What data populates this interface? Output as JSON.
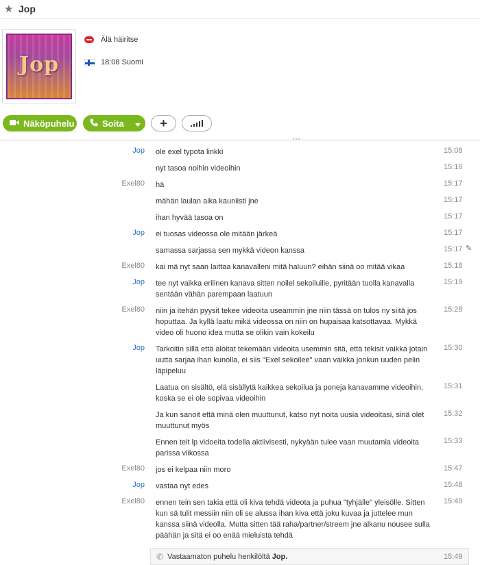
{
  "header": {
    "title": "Jop"
  },
  "profile": {
    "avatar_text": "Jop",
    "status": "Älä häiritse",
    "local_time": "18:08 Suomi"
  },
  "actions": {
    "video_call": "Näköpuhelu",
    "call": "Soita"
  },
  "messages": [
    {
      "sender": "Jop",
      "text": "ole exel typota linkki",
      "time": "15:08"
    },
    {
      "sender": "",
      "text": "nyt tasoa noihin videoihin",
      "time": "15:16"
    },
    {
      "sender": "Exel80",
      "text": "hä",
      "time": "15:17"
    },
    {
      "sender": "",
      "text": "mähän laulan aika kauniisti jne",
      "time": "15:17"
    },
    {
      "sender": "",
      "text": "ihan hyvää tasoa on",
      "time": "15:17"
    },
    {
      "sender": "Jop",
      "text": "ei tuosas videossa ole mitään järkeä",
      "time": "15:17"
    },
    {
      "sender": "",
      "text": "samassa sarjassa sen mykkä videon kanssa",
      "time": "15:17"
    },
    {
      "sender": "Exel80",
      "text": "kai mä nyt saan laittaa kanavalleni mitä haluun? eihän siinä oo mitää vikaa",
      "time": "15:18"
    },
    {
      "sender": "Jop",
      "text": "tee nyt vaikka erilinen kanava sitten noilel sekoiluille, pyritään tuolla kanavalla sentään vähän parempaan laatuun",
      "time": "15:19"
    },
    {
      "sender": "Exel80",
      "text": "niin ja itehän pyysit tekee videoita useammin jne niin tässä on tulos ny siitä jos hoputtaa. Ja kyllä laatu mikä videossa on niin on hupaisaa katsottavaa. Mykkä video oli huono idea mutta se olikin vain kokeilu",
      "time": "15:28"
    },
    {
      "sender": "Jop",
      "text": "Tarkoitin sillä että aloitat tekemään videoita usemmin sitä, että tekisit vaikka jotain uutta sarjaa ihan kunolla, ei siis \"Exel sekoilee\" vaan vaikka jonkun uuden pelin läpipeluu",
      "time": "15:30"
    },
    {
      "sender": "",
      "text": "Laatua on sisältö, elä sisällytä kaikkea sekoilua ja poneja kanavamme videoihin, koska se ei ole sopivaa videoihin",
      "time": "15:31"
    },
    {
      "sender": "",
      "text": "Ja kun sanoit että minä olen muuttunut, katso nyt noita uusia videoitasi, sinä olet muuttunut myös",
      "time": "15:32"
    },
    {
      "sender": "",
      "text": "Ennen teit lp vidoeita todella aktiivisesti, nykyään tulee vaan muutamia videoita parissa viikossa",
      "time": "15:33"
    },
    {
      "sender": "Exel80",
      "text": "jos ei kelpaa niin moro",
      "time": "15:47"
    },
    {
      "sender": "Jop",
      "text": "vastaa nyt edes",
      "time": "15:48"
    },
    {
      "sender": "Exel80",
      "text": "ennen tein sen takia että oli kiva tehdä videota ja puhua \"tyhjälle\" yleisölle. Sitten kun sä tulit messiin niin oli se alussa ihan kiva että joku kuvaa ja juttelee mun kanssa siinä videolla. Mutta sitten tää raha/partner/streem jne alkanu nousee sulla päähän ja sitä ei oo enää mieluista tehdä",
      "time": "15:49"
    }
  ],
  "missed_call": {
    "text": "Vastaamaton puhelu henkilöltä",
    "name": "Jop.",
    "time": "15:49"
  },
  "colors": {
    "accent_green": "#7ab81e",
    "link_blue": "#2b74c4",
    "dnd_red": "#e0242c"
  }
}
